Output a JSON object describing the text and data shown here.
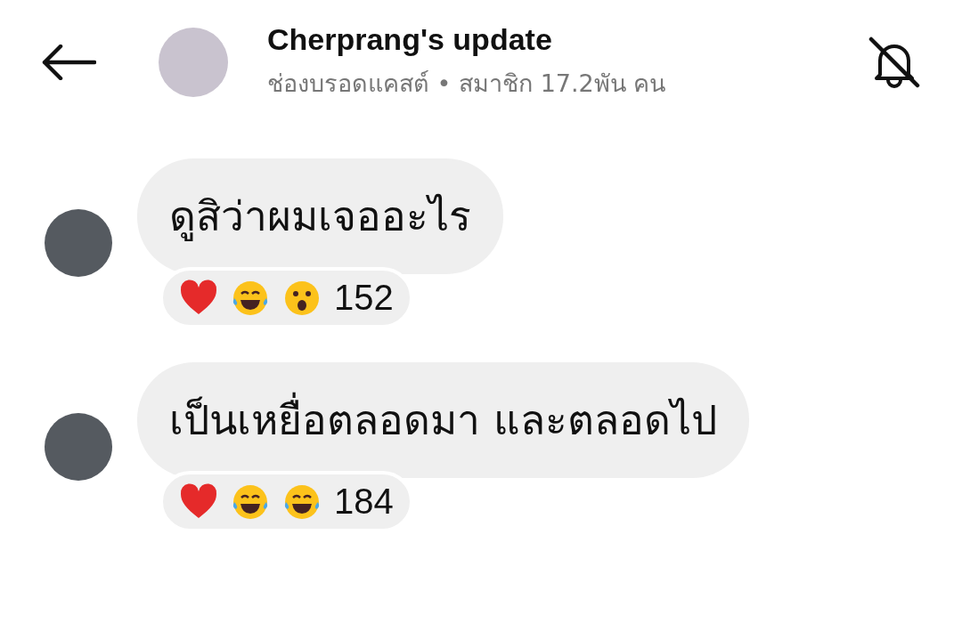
{
  "header": {
    "title": "Cherprang's update",
    "subtitle": "ช่องบรอดแคสต์ • สมาชิก 17.2พัน คน",
    "muted": true
  },
  "messages": [
    {
      "text": "ดูสิว่าผมเจออะไร",
      "reactions": [
        {
          "kind": "heart"
        },
        {
          "kind": "joy"
        },
        {
          "kind": "wow"
        }
      ],
      "count": "152"
    },
    {
      "text": "เป็นเหยื่อตลอดมา  และตลอดไป",
      "reactions": [
        {
          "kind": "heart"
        },
        {
          "kind": "joy"
        },
        {
          "kind": "rofl"
        }
      ],
      "count": "184"
    }
  ]
}
